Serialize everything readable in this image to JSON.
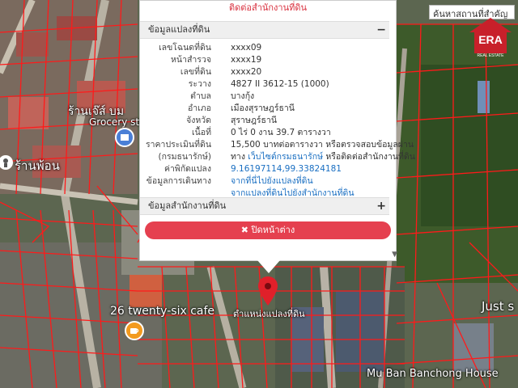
{
  "colors": {
    "accent": "#e5404f",
    "link": "#1a6fc2",
    "parcel_lines": "#ff1a1a"
  },
  "map": {
    "labels": {
      "shop1": "ร้านเจ๊ส์ บม",
      "grocery": "Grocery sto",
      "shop2": "ร้านพ้อน",
      "cafe": "26 twenty-six cafe",
      "location": "ตำแหน่งแปลงที่ดิน",
      "just": "Just s",
      "village": "Mu Ban Banchong House"
    },
    "search_text": "ค้นหาสถานที่สำคัญ",
    "logo_text": "ERA",
    "logo_subtext": "REAL ESTATE",
    "icons": [
      "map-pin-icon",
      "cafe-icon",
      "store-icon",
      "place-icon"
    ]
  },
  "popup": {
    "top_text": "ติดต่อสำนักงานที่ดิน",
    "section1": {
      "title": "ข้อมูลแปลงที่ดิน",
      "toggle": "−"
    },
    "rows": [
      {
        "label": "เลขโฉนดที่ดิน",
        "value": "xxxx09"
      },
      {
        "label": "หน้าสำรวจ",
        "value": "xxxx19"
      },
      {
        "label": "เลขที่ดิน",
        "value": "xxxx20"
      },
      {
        "label": "ระวาง",
        "value": "4827 II 3612-15 (1000)"
      },
      {
        "label": "ตำบล",
        "value": "บางกุ้ง"
      },
      {
        "label": "อำเภอ",
        "value": "เมืองสุราษฎร์ธานี"
      },
      {
        "label": "จังหวัด",
        "value": "สุราษฎร์ธานี"
      },
      {
        "label": "เนื้อที่",
        "value": "0 ไร่ 0 งาน 39.7 ตารางวา"
      },
      {
        "label": "ราคาประเมินที่ดิน",
        "value": "15,500 บาทต่อตารางวา หรือตรวจสอบข้อมูลผ่าน"
      },
      {
        "label": "(กรมธนารักษ์)",
        "value_prefix": "ทาง ",
        "value_link": "เว็บไซต์กรมธนารักษ์",
        "value_suffix": " หรือติดต่อสำนักงานที่ดิน"
      },
      {
        "label": "ค่าพิกัดแปลง",
        "value": "9.16197114,99.33824181"
      },
      {
        "label": "ข้อมูลการเดินทาง",
        "value": "จากที่นี่ไปยังแปลงที่ดิน"
      },
      {
        "label": "",
        "value": "จากแปลงที่ดินไปยังสำนักงานที่ดิน"
      }
    ],
    "section2": {
      "title": "ข้อมูลสำนักงานที่ดิน",
      "toggle": "+"
    },
    "close_label": "✖ ปิดหน้าต่าง",
    "scroll_arrow": "▼"
  }
}
